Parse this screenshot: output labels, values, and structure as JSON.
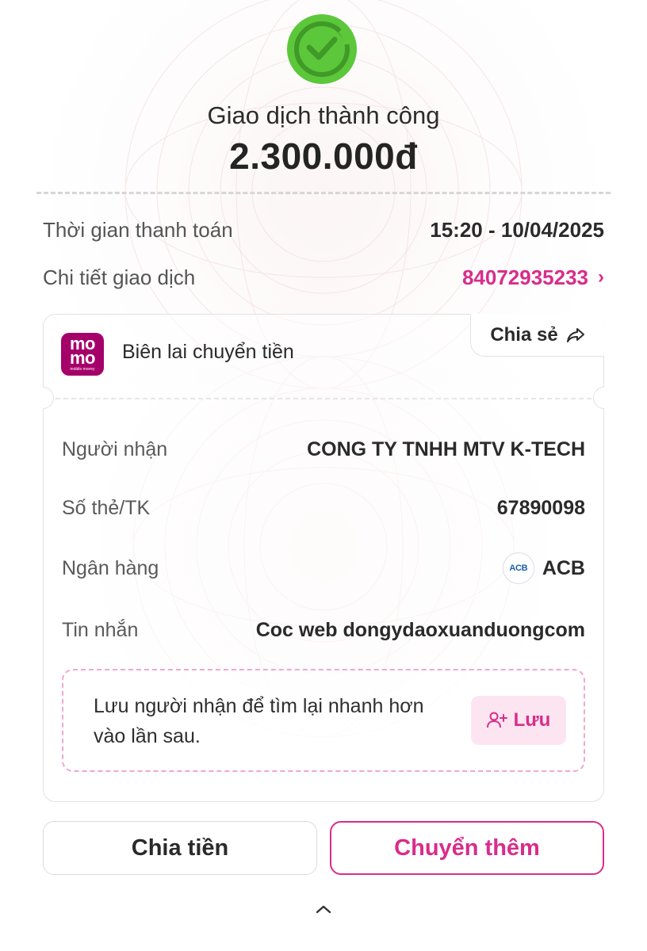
{
  "status": {
    "title": "Giao dịch thành công",
    "amount": "2.300.000đ",
    "icon": "check-circle-icon",
    "success_color": "#5cc73a"
  },
  "summary": {
    "time_label": "Thời gian thanh toán",
    "time_value": "15:20 - 10/04/2025",
    "detail_label": "Chi tiết giao dịch",
    "detail_value": "84072935233",
    "detail_chevron": "›"
  },
  "receipt": {
    "logo": {
      "line1": "mo",
      "line2": "mo",
      "tagline": "mobile money",
      "brand_color": "#a5006a"
    },
    "title": "Biên lai chuyển tiền",
    "share_label": "Chia sẻ",
    "rows": [
      {
        "label": "Người nhận",
        "value": "CONG TY TNHH MTV K-TECH"
      },
      {
        "label": "Số thẻ/TK",
        "value": "67890098"
      },
      {
        "label": "Ngân hàng",
        "value": "ACB",
        "bank_logo_text": "ACB"
      },
      {
        "label": "Tin nhắn",
        "value": "Coc web dongydaoxuanduongcom"
      }
    ],
    "save_prompt": "Lưu người nhận để tìm lại nhanh hơn vào lần sau.",
    "save_button": "Lưu"
  },
  "actions": {
    "split_label": "Chia tiền",
    "transfer_label": "Chuyển thêm"
  },
  "accent_color": "#d82d8b"
}
